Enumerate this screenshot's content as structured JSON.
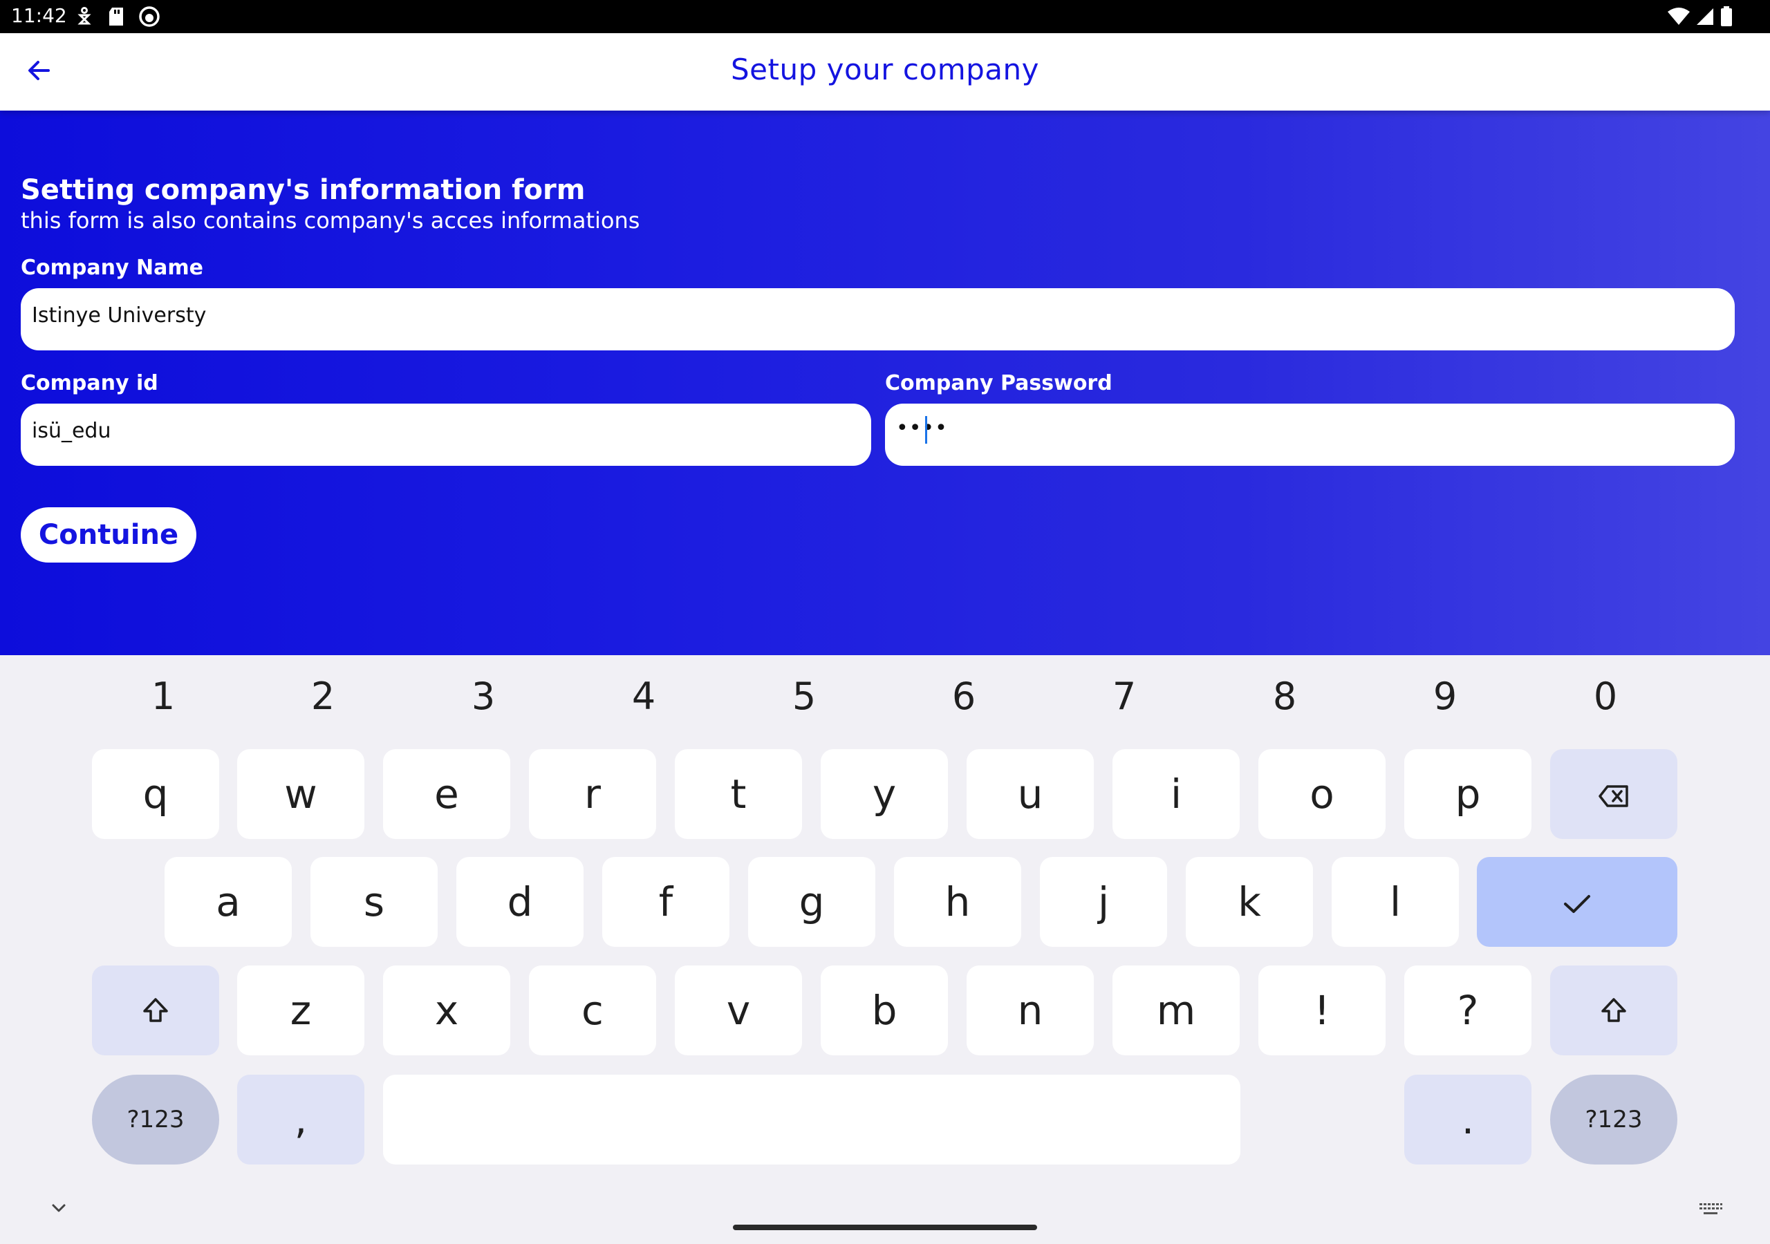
{
  "status_bar": {
    "time": "11:42"
  },
  "app_bar": {
    "title": "Setup your company"
  },
  "form": {
    "title": "Setting company's information form",
    "subtitle": "this form is also contains company's acces informations",
    "company_name": {
      "label": "Company Name",
      "value": "Istinye Universty"
    },
    "company_id": {
      "label": "Company id",
      "value": "isü_edu"
    },
    "company_password": {
      "label": "Company Password",
      "masked_value": "••••"
    },
    "continue_label": "Contuine"
  },
  "keyboard": {
    "numbers": [
      "1",
      "2",
      "3",
      "4",
      "5",
      "6",
      "7",
      "8",
      "9",
      "0"
    ],
    "row1": [
      "q",
      "w",
      "e",
      "r",
      "t",
      "y",
      "u",
      "i",
      "o",
      "p"
    ],
    "row2": [
      "a",
      "s",
      "d",
      "f",
      "g",
      "h",
      "j",
      "k",
      "l"
    ],
    "row3": [
      "z",
      "x",
      "c",
      "v",
      "b",
      "n",
      "m",
      "!",
      "?"
    ],
    "row4": {
      "symbols_left": "?123",
      "comma": ",",
      "period": ".",
      "symbols_right": "?123"
    }
  },
  "colors": {
    "brand_blue": "#1414e0",
    "gradient_start": "#0d0ddb",
    "gradient_end": "#4444e2",
    "keyboard_bg": "#f1f0f5",
    "enter_key": "#b3c5fb"
  }
}
